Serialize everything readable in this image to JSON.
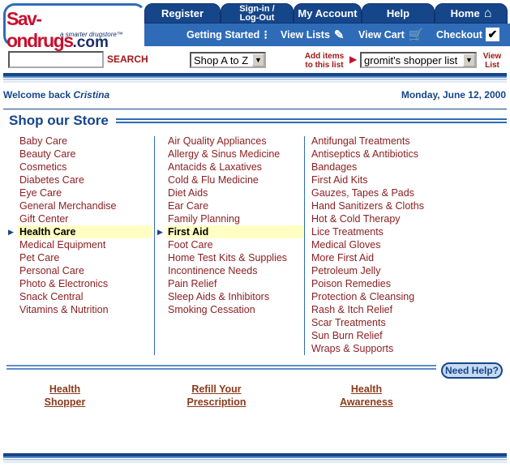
{
  "logo": {
    "wordmark": "Sav-ondrugs",
    "dotcom": ".com",
    "tagline": "a smarter drugstore™"
  },
  "nav_top": {
    "register": "Register",
    "sign_in_line1": "Sign-in /",
    "sign_in_line2": "Log-Out",
    "my_account": "My Account",
    "help": "Help",
    "home": "Home"
  },
  "nav_second": {
    "getting_started": "Getting Started",
    "view_lists": "View Lists",
    "view_cart": "View Cart",
    "checkout": "Checkout"
  },
  "search": {
    "value": "",
    "button_label": "SEARCH"
  },
  "sort_select": {
    "selected": "Shop A to Z"
  },
  "add_items_label_1": "Add items",
  "add_items_label_2": "to this list",
  "shopper_list_select": {
    "selected": "gromit's shopper list"
  },
  "view_list_1": "View",
  "view_list_2": "List",
  "welcome": {
    "prefix": "Welcome back ",
    "name": "Cristina"
  },
  "date": "Monday, June 12, 2000",
  "shop_title": "Shop our Store",
  "categories": {
    "col1": [
      "Baby Care",
      "Beauty Care",
      "Cosmetics",
      "Diabetes Care",
      "Eye Care",
      "General Merchandise",
      "Gift Center",
      "Health Care",
      "Medical Equipment",
      "Pet Care",
      "Personal Care",
      "Photo & Electronics",
      "Snack Central",
      "Vitamins & Nutrition"
    ],
    "col2": [
      "Air Quality Appliances",
      "Allergy & Sinus Medicine",
      "Antacids & Laxatives",
      "Cold & Flu Medicine",
      "Diet Aids",
      "Ear Care",
      "Family Planning",
      "First Aid",
      "Foot Care",
      "Home Test Kits & Supplies",
      "Incontinence Needs",
      "Pain Relief",
      "Sleep Aids & Inhibitors",
      "Smoking Cessation"
    ],
    "col3": [
      "Antifungal Treatments",
      "Antiseptics & Antibiotics",
      "Bandages",
      "First Aid Kits",
      "Gauzes, Tapes & Pads",
      "Hand Sanitizers & Cloths",
      "Hot & Cold Therapy",
      "Lice Treatments",
      "Medical Gloves",
      "More First Aid",
      "Petroleum Jelly",
      "Poison Remedies",
      "Protection & Cleansing",
      "Rash & Itch Relief",
      "Scar Treatments",
      "Sun Burn Relief",
      "Wraps & Supports"
    ]
  },
  "need_help": "Need Help?",
  "footer_links": {
    "health_shopper_1": "Health",
    "health_shopper_2": "Shopper",
    "refill_1": "Refill Your",
    "refill_2": "Prescription",
    "awareness_1": "Health",
    "awareness_2": "Awareness"
  },
  "colors": {
    "brand_red": "#c8102e",
    "brand_blue": "#16468a",
    "link": "#8b2023",
    "highlight": "#ffffc4"
  }
}
